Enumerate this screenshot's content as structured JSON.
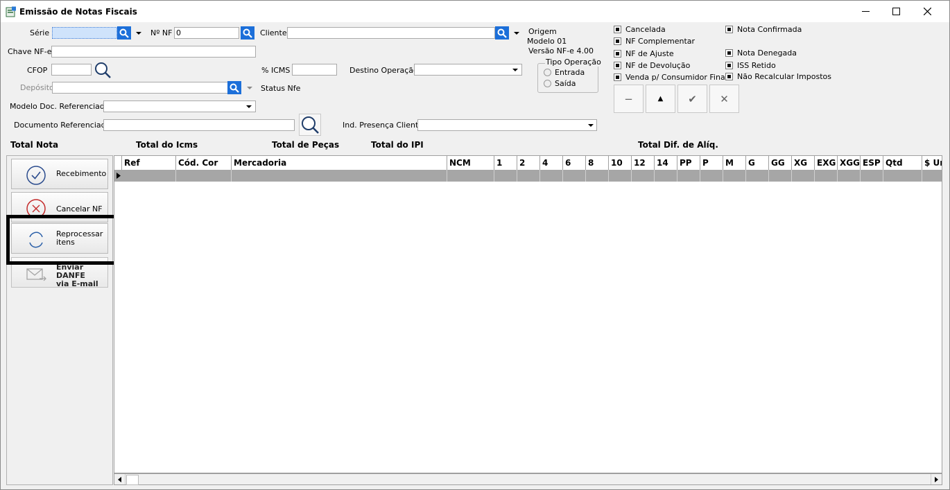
{
  "window": {
    "title": "Emissão de Notas Fiscais"
  },
  "form": {
    "serie_label": "Série",
    "nf_label": "Nº NF",
    "nf_value": "0",
    "cliente_label": "Cliente",
    "chave_label": "Chave NF-e",
    "cfop_label": "CFOP",
    "icms_label": "% ICMS",
    "destino_label": "Destino Operação",
    "deposito_label": "Depósito",
    "status_label": "Status Nfe",
    "modelo_doc_label": "Modelo Doc. Referenciado",
    "documento_ref_label": "Documento Referenciado",
    "ind_presenca_label": "Ind. Presença Cliente"
  },
  "origem": {
    "origem": "Origem",
    "modelo": "Modelo 01",
    "versao": "Versão NF-e 4.00"
  },
  "tipo_operacao": {
    "label": "Tipo Operação",
    "entrada": "Entrada",
    "saida": "Saída"
  },
  "checkboxes": {
    "cancelada": "Cancelada",
    "nf_complementar": "NF Complementar",
    "nf_ajuste": "NF de Ajuste",
    "nf_devolucao": "NF de Devolução",
    "venda_consumidor": "Venda p/ Consumidor Final",
    "nota_confirmada": "Nota Confirmada",
    "nota_denegada": "Nota Denegada",
    "iss_retido": "ISS Retido",
    "nao_recalcular": "Não Recalcular Impostos"
  },
  "nav_buttons": {
    "minus": "−",
    "up": "▲",
    "check": "✔",
    "cancel": "✕"
  },
  "totals": {
    "total_nota": "Total Nota",
    "total_icms": "Total do Icms",
    "total_pecas": "Total de Peças",
    "total_ipi": "Total do IPI",
    "total_dif": "Total Dif. de Alíq."
  },
  "side_buttons": {
    "recebimento": "Recebimento",
    "cancelar_nf": "Cancelar NF",
    "reprocessar_1": "Reprocessar",
    "reprocessar_2": "itens",
    "enviar_1": "Enviar DANFE",
    "enviar_2": "via E-mail"
  },
  "grid": {
    "columns": [
      "Ref",
      "Cód. Cor",
      "Mercadoria",
      "NCM",
      "1",
      "2",
      "4",
      "6",
      "8",
      "10",
      "12",
      "14",
      "PP",
      "P",
      "M",
      "G",
      "GG",
      "XG",
      "EXG",
      "XGG",
      "ESP",
      "Qtd",
      "$ Un"
    ]
  },
  "colors": {
    "accent_blue": "#1c6fd9",
    "row_gray": "#a6a6a6"
  }
}
